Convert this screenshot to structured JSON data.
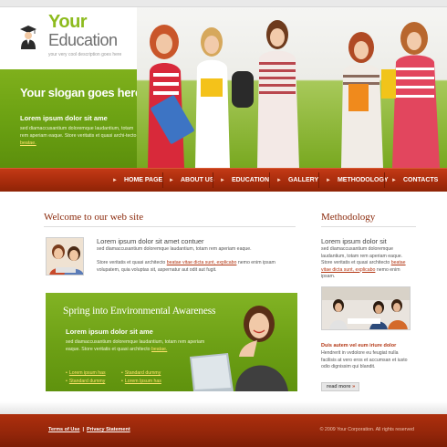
{
  "header": {
    "logo": {
      "line1": "Your",
      "line2": "Education",
      "description": "your very cool description goes here"
    },
    "slogan": "Your slogan goes here",
    "hero_subtitle": "Lorem ipsum dolor sit ame",
    "hero_text": "sed diamaccusantium doloremque laudantium, totam rem aperiam eaque. Store veritatis et quasi archi-tecto",
    "hero_link": "beatae."
  },
  "nav": {
    "items": [
      {
        "label": "HOME PAGE"
      },
      {
        "label": "ABOUT US"
      },
      {
        "label": "EDUCATION"
      },
      {
        "label": "GALLERY"
      },
      {
        "label": "METHODOLOGY"
      },
      {
        "label": "CONTACTS"
      }
    ]
  },
  "welcome": {
    "heading": "Welcome to our web site",
    "title": "Lorem ipsum dolor sit amet contuer",
    "p1": "sed diamaccusantium doloremque laudantium, totam rem aperiam eaque.",
    "p2_before": "Store veritatis et quasi architecto ",
    "p2_link": "beatae vitae dicta sunt, explicabo",
    "p2_after": " nemo enim ipsam volupatem, quia voluptas sit, aspernatur aut odit aut fugit."
  },
  "spring": {
    "title": "Spring into Environmental Awareness",
    "subtitle": "Lorem ipsum dolor sit ame",
    "text": "sed diamaccusantium doloremque laudantium, totam rem aperiam eaque. Store veritatis et quasi architecto",
    "text_link": "beatae.",
    "links": [
      "Lorem ipsum has",
      "Standard dummy",
      "Standard dummy",
      "Lorem Ipsum has"
    ]
  },
  "methodology": {
    "heading": "Methodology",
    "title": "Lorem ipsum dolor sit",
    "p1_before": "sed diamaccusantium doloremque laudantium, totam rem aperiam eaque. Store veritatis et quasi architecto ",
    "p1_link": "beatae vitae dicta sunt, explicabo",
    "p1_after": " nemo enim ipsam.",
    "subtitle": "Duis autem vel eum iriure dolor",
    "p2": "Hendrerit in vvdolore eu feugiat nulla facilisis at vero eros et accumsan et iusto odio dignissim qui blandit.",
    "read_more": "read more"
  },
  "footer": {
    "terms": "Terms of Use",
    "separator": "|",
    "privacy": "Privacy Statement",
    "copyright": "© 2009 Your Corporation. All rights reserved"
  },
  "colors": {
    "brand_green": "#7fb01c",
    "brand_red": "#a82c0c",
    "heading_red": "#8b2a0c",
    "link_yellow": "#ffe36b"
  }
}
